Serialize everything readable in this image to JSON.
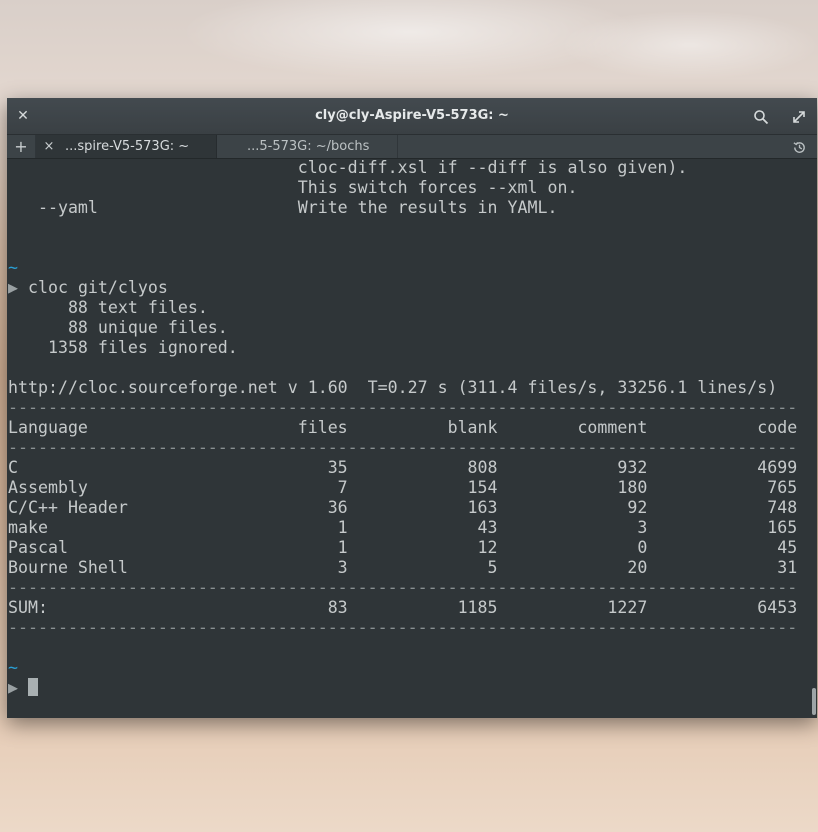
{
  "window": {
    "title": "cly@cly-Aspire-V5-573G: ~",
    "close_icon": "close-icon",
    "search_icon": "search-icon",
    "maximize_icon": "maximize-icon"
  },
  "tabs": {
    "add_label": "+",
    "close_label": "×",
    "items": [
      {
        "label": "...spire-V5-573G: ~",
        "active": true
      },
      {
        "label": "...5-573G: ~/bochs",
        "active": false
      }
    ],
    "history_icon": "history-icon"
  },
  "terminal": {
    "lines": [
      "                             cloc-diff.xsl if --diff is also given).",
      "                             This switch forces --xml on.",
      "   --yaml                    Write the results in YAML.",
      "",
      "",
      "~",
      "▶ cloc git/clyos",
      "      88 text files.",
      "      88 unique files.",
      "    1358 files ignored.",
      "",
      "http://cloc.sourceforge.net v 1.60  T=0.27 s (311.4 files/s, 33256.1 lines/s)",
      "-------------------------------------------------------------------------------",
      "Language                     files          blank        comment           code",
      "-------------------------------------------------------------------------------",
      "C                               35            808            932           4699",
      "Assembly                         7            154            180            765",
      "C/C++ Header                    36            163             92            748",
      "make                             1             43              3            165",
      "Pascal                           1             12              0             45",
      "Bourne Shell                     3              5             20             31",
      "-------------------------------------------------------------------------------",
      "SUM:                            83           1185           1227           6453",
      "-------------------------------------------------------------------------------",
      "",
      "~",
      "▶ "
    ],
    "colors": {
      "text": "#c5c9ca",
      "tilde": "#2aa0d6",
      "background": "#2f3538"
    }
  }
}
